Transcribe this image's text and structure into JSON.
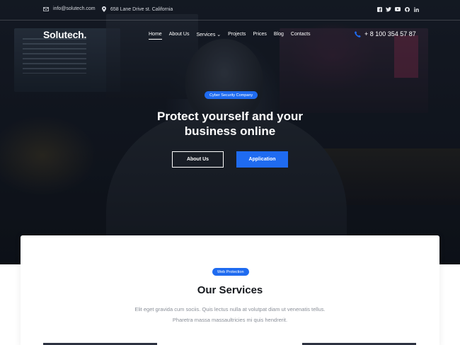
{
  "topbar": {
    "email": "info@solutech.com",
    "address": "658 Lane Drive st. California",
    "social_icons": [
      "facebook-icon",
      "twitter-icon",
      "youtube-icon",
      "github-icon",
      "linkedin-icon"
    ]
  },
  "nav": {
    "logo": "Solutech.",
    "items": [
      {
        "label": "Home",
        "active": true
      },
      {
        "label": "About Us"
      },
      {
        "label": "Services ⌄"
      },
      {
        "label": "Projects"
      },
      {
        "label": "Prices"
      },
      {
        "label": "Blog"
      },
      {
        "label": "Contacts"
      }
    ],
    "phone": "+ 8 100 354 57 87"
  },
  "hero": {
    "badge": "Cyber Security Company",
    "title_line1": "Protect yourself and your",
    "title_line2": "business online",
    "btn_about": "About Us",
    "btn_application": "Application"
  },
  "services": {
    "badge": "Web Protection",
    "title": "Our Services",
    "text_line1": "Elit eget gravida cum sociis. Quis lectus nulla at volutpat diam ut venenatis tellus.",
    "text_line2": "Pharetra massa massaultricies mi quis hendrerit."
  },
  "colors": {
    "accent": "#1f6bf0",
    "hero_bg": "#141821",
    "heading": "#15181d",
    "muted_text": "#8a8f98"
  }
}
